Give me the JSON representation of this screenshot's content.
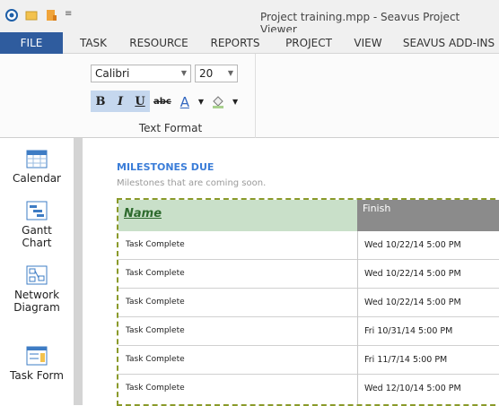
{
  "window": {
    "title": "Project training.mpp - Seavus Project Viewer"
  },
  "quick_access": [
    "app-icon",
    "open-icon",
    "save-icon",
    "customize-icon"
  ],
  "tabs": [
    "FILE",
    "TASK",
    "RESOURCE",
    "REPORTS",
    "PROJECT",
    "VIEW",
    "SEAVUS ADD-INS"
  ],
  "ribbon": {
    "font_name": "Calibri",
    "font_size": "20",
    "bold": "B",
    "italic": "I",
    "underline": "U",
    "strike": "abc",
    "font_color_glyph": "A",
    "group_label": "Text Format"
  },
  "sidebar": {
    "items": [
      {
        "label": "Calendar",
        "icon": "calendar-icon"
      },
      {
        "label": "Gantt Chart",
        "icon": "gantt-chart-icon"
      },
      {
        "label": "Network Diagram",
        "icon": "network-diagram-icon"
      },
      {
        "label": "Task Form",
        "icon": "task-form-icon"
      }
    ]
  },
  "main": {
    "title": "MILESTONES DUE",
    "subtitle": "Milestones that are coming soon.",
    "columns": [
      "Name",
      "Finish"
    ],
    "rows": [
      {
        "name": "Task Complete",
        "finish": "Wed 10/22/14 5:00 PM"
      },
      {
        "name": "Task Complete",
        "finish": "Wed 10/22/14 5:00 PM"
      },
      {
        "name": "Task Complete",
        "finish": "Wed 10/22/14 5:00 PM"
      },
      {
        "name": "Task Complete",
        "finish": "Fri 10/31/14 5:00 PM"
      },
      {
        "name": "Task Complete",
        "finish": "Fri 11/7/14 5:00 PM"
      },
      {
        "name": "Task Complete",
        "finish": "Wed 12/10/14 5:00 PM"
      }
    ]
  },
  "colors": {
    "file_tab": "#2f5c9e",
    "accent_title": "#3b7dd8",
    "header_name_bg": "#c9e0c9",
    "header_finish_bg": "#8b8b8b",
    "selection_border": "#8a9a2a"
  }
}
